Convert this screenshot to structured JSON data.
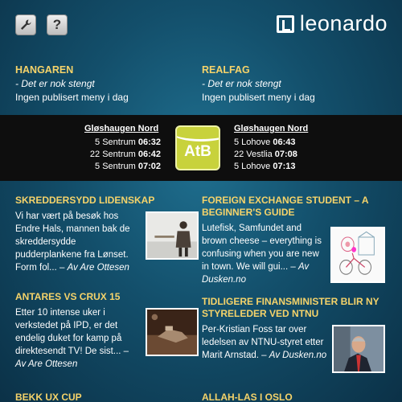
{
  "header": {
    "logo_text": "leonardo",
    "settings_icon": "wrench-icon",
    "help_label": "?"
  },
  "cafeterias": [
    {
      "name": "HANGAREN",
      "status": "- Det er nok stengt",
      "menu": "Ingen publisert meny i dag"
    },
    {
      "name": "REALFAG",
      "status": "- Det er nok stengt",
      "menu": "Ingen publisert meny i dag"
    }
  ],
  "bus": {
    "logo_text": "AtB",
    "left": {
      "stop": "Gløshaugen Nord",
      "departures": [
        {
          "route": "5 Sentrum",
          "time": "06:32"
        },
        {
          "route": "22 Sentrum",
          "time": "06:42"
        },
        {
          "route": "5 Sentrum",
          "time": "07:02"
        }
      ]
    },
    "right": {
      "stop": "Gløshaugen Nord",
      "departures": [
        {
          "route": "5 Lohove",
          "time": "06:43"
        },
        {
          "route": "22 Vestlia",
          "time": "07:08"
        },
        {
          "route": "5 Lohove",
          "time": "07:13"
        }
      ]
    }
  },
  "articles": [
    {
      "title": "SKREDDERSYDD LIDENSKAP",
      "text": "Vi har vært på besøk hos Endre Hals, mannen bak de skreddersydde pudderplankene fra Lønset. Form fol... –",
      "author": "Av Are Ottesen"
    },
    {
      "title": "FOREIGN EXCHANGE STUDENT – A BEGINNER'S GUIDE",
      "text": "Lutefisk, Samfundet and brown cheese – everything is confusing when you are new in town. We will gui... –",
      "author": "Av Dusken.no"
    },
    {
      "title": "ANTARES VS CRUX 15",
      "text": "Etter 10 intense uker i verkstedet på IPD, er det endelig duket for kamp på direktesendt TV! De sist... –",
      "author": "Av Are Ottesen"
    },
    {
      "title": "TIDLIGERE FINANSMINISTER BLIR NY STYRELEDER VED NTNU",
      "text": "Per-Kristian Foss tar over ledelsen av NTNU-styret etter Marit Arnstad. –",
      "author": "Av Dusken.no"
    },
    {
      "title": "BEKK UX CUP",
      "text": "",
      "author": ""
    },
    {
      "title": "ALLAH-LAS I OSLO",
      "text": "",
      "author": ""
    }
  ],
  "colors": {
    "accent": "#f5d36a",
    "background": "#134f6b",
    "band": "#0e0e0e",
    "atb_green": "#c8d23c"
  }
}
